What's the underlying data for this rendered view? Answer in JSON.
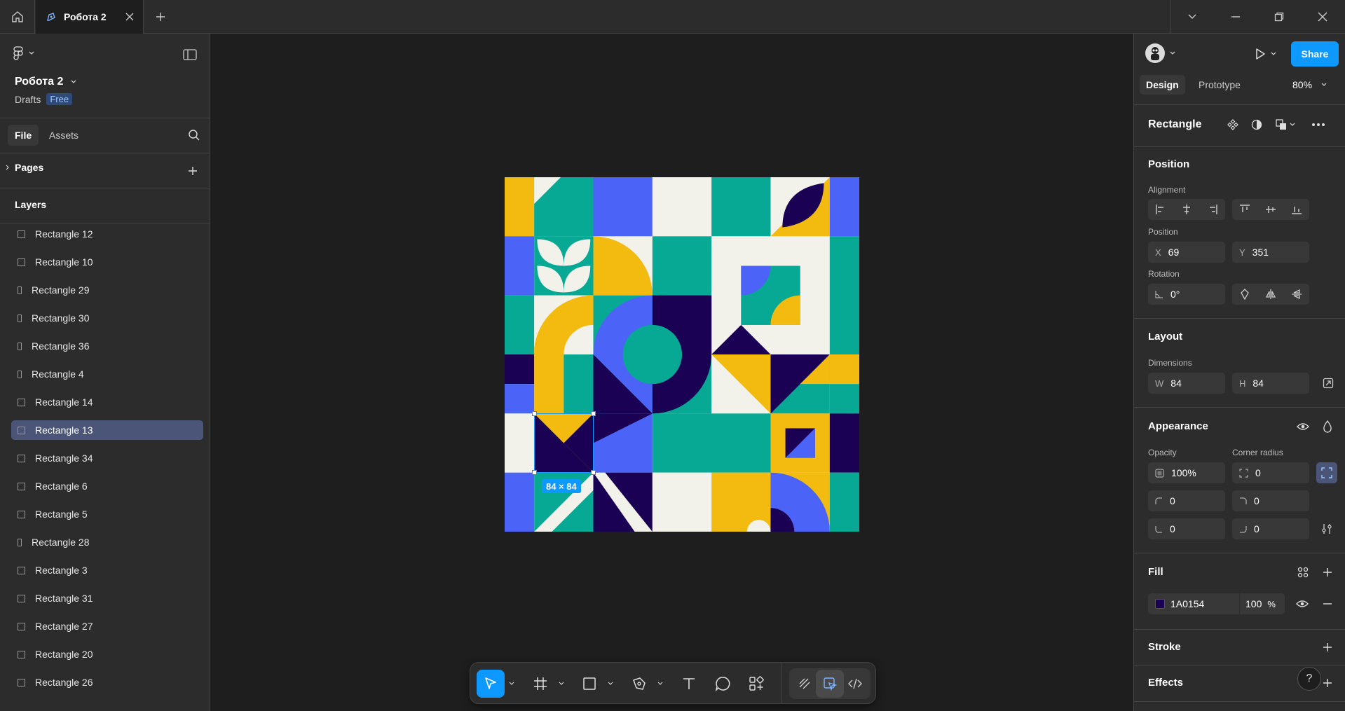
{
  "tabs": [
    {
      "label": "Робота 2"
    }
  ],
  "file": {
    "name": "Робота 2",
    "location": "Drafts",
    "plan": "Free"
  },
  "left": {
    "tab_file": "File",
    "tab_assets": "Assets",
    "pages_label": "Pages",
    "layers_label": "Layers",
    "layers": [
      {
        "label": "Rectangle 12"
      },
      {
        "label": "Rectangle 10"
      },
      {
        "label": "Rectangle 29"
      },
      {
        "label": "Rectangle 30"
      },
      {
        "label": "Rectangle 36"
      },
      {
        "label": "Rectangle 4"
      },
      {
        "label": "Rectangle 14"
      },
      {
        "label": "Rectangle 13",
        "selected": true
      },
      {
        "label": "Rectangle 34"
      },
      {
        "label": "Rectangle 6"
      },
      {
        "label": "Rectangle 5"
      },
      {
        "label": "Rectangle 28"
      },
      {
        "label": "Rectangle 3"
      },
      {
        "label": "Rectangle 31"
      },
      {
        "label": "Rectangle 27"
      },
      {
        "label": "Rectangle 20"
      },
      {
        "label": "Rectangle 26"
      }
    ]
  },
  "canvas": {
    "selection_size": "84 × 84"
  },
  "right": {
    "share": "Share",
    "tab_design": "Design",
    "tab_prototype": "Prototype",
    "zoom": "80%",
    "element_title": "Rectangle",
    "position": {
      "title": "Position",
      "alignment_label": "Alignment",
      "position_label": "Position",
      "x_label": "X",
      "x": "69",
      "y_label": "Y",
      "y": "351",
      "rotation_label": "Rotation",
      "rotation": "0°"
    },
    "layout": {
      "title": "Layout",
      "dimensions_label": "Dimensions",
      "w_label": "W",
      "w": "84",
      "h_label": "H",
      "h": "84"
    },
    "appearance": {
      "title": "Appearance",
      "opacity_label": "Opacity",
      "opacity": "100%",
      "radius_label": "Corner radius",
      "radius": "0",
      "tl": "0",
      "tr": "0",
      "bl": "0",
      "br": "0"
    },
    "fill": {
      "title": "Fill",
      "hex": "1A0154",
      "opacity": "100",
      "unit": "%",
      "swatch": "#1a0154"
    },
    "stroke": {
      "title": "Stroke"
    },
    "effects": {
      "title": "Effects"
    }
  },
  "colors": {
    "navy": "#1a0154",
    "blue": "#4b63f6",
    "teal": "#07a995",
    "yellow": "#f3bb10",
    "cream": "#f2f1ea",
    "accent": "#0d99ff"
  }
}
